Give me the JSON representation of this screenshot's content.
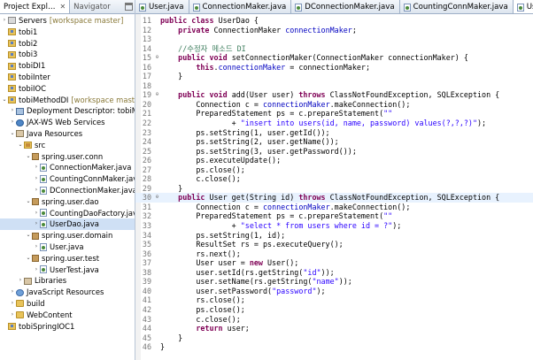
{
  "explorer": {
    "tab_label": "Project Expl…",
    "tab_close": "✕",
    "navigator_label": "Navigator",
    "tree": [
      {
        "depth": 0,
        "twisty": "›",
        "icon": "ic-serv",
        "icon_name": "server-icon",
        "label": "Servers",
        "ws": "[workspace master]"
      },
      {
        "depth": 0,
        "twisty": "",
        "icon": "ic-project",
        "icon_name": "project-icon",
        "label": "tobi1",
        "ws": ""
      },
      {
        "depth": 0,
        "twisty": "",
        "icon": "ic-project",
        "icon_name": "project-icon",
        "label": "tobi2",
        "ws": ""
      },
      {
        "depth": 0,
        "twisty": "",
        "icon": "ic-project",
        "icon_name": "project-icon",
        "label": "tobi3",
        "ws": ""
      },
      {
        "depth": 0,
        "twisty": "",
        "icon": "ic-project",
        "icon_name": "project-icon",
        "label": "tobiDI1",
        "ws": ""
      },
      {
        "depth": 0,
        "twisty": "",
        "icon": "ic-project",
        "icon_name": "project-icon",
        "label": "tobiInter",
        "ws": ""
      },
      {
        "depth": 0,
        "twisty": "",
        "icon": "ic-project",
        "icon_name": "project-icon",
        "label": "tobiIOC",
        "ws": ""
      },
      {
        "depth": 0,
        "twisty": "⌄",
        "icon": "ic-project",
        "icon_name": "project-icon",
        "label": "tobiMethodDI",
        "ws": "[workspace master]"
      },
      {
        "depth": 1,
        "twisty": "›",
        "icon": "ic-dd",
        "icon_name": "deployment-descriptor-icon",
        "label": "Deployment Descriptor: tobiMethodD",
        "ws": ""
      },
      {
        "depth": 1,
        "twisty": "›",
        "icon": "ic-jax",
        "icon_name": "web-services-icon",
        "label": "JAX-WS Web Services",
        "ws": ""
      },
      {
        "depth": 1,
        "twisty": "⌄",
        "icon": "ic-lib",
        "icon_name": "java-resources-icon",
        "label": "Java Resources",
        "ws": ""
      },
      {
        "depth": 2,
        "twisty": "⌄",
        "icon": "ic-src",
        "icon_name": "source-folder-icon",
        "label": "src",
        "ws": ""
      },
      {
        "depth": 3,
        "twisty": "⌄",
        "icon": "ic-pkg",
        "icon_name": "package-icon",
        "label": "spring.user.conn",
        "ws": ""
      },
      {
        "depth": 4,
        "twisty": "›",
        "icon": "ic-java",
        "icon_name": "java-file-icon",
        "label": "ConnectionMaker.java",
        "ws": ""
      },
      {
        "depth": 4,
        "twisty": "›",
        "icon": "ic-java",
        "icon_name": "java-file-icon",
        "label": "CountingConnMaker.java",
        "ws": ""
      },
      {
        "depth": 4,
        "twisty": "›",
        "icon": "ic-java",
        "icon_name": "java-file-icon",
        "label": "DConnectionMaker.java",
        "ws": ""
      },
      {
        "depth": 3,
        "twisty": "⌄",
        "icon": "ic-pkg",
        "icon_name": "package-icon",
        "label": "spring.user.dao",
        "ws": ""
      },
      {
        "depth": 4,
        "twisty": "›",
        "icon": "ic-java",
        "icon_name": "java-file-icon",
        "label": "CountingDaoFactory.java",
        "ws": ""
      },
      {
        "depth": 4,
        "twisty": "›",
        "icon": "ic-java",
        "icon_name": "java-file-icon",
        "label": "UserDao.java",
        "ws": "",
        "selected": true
      },
      {
        "depth": 3,
        "twisty": "⌄",
        "icon": "ic-pkg",
        "icon_name": "package-icon",
        "label": "spring.user.domain",
        "ws": ""
      },
      {
        "depth": 4,
        "twisty": "›",
        "icon": "ic-java",
        "icon_name": "java-file-icon",
        "label": "User.java",
        "ws": ""
      },
      {
        "depth": 3,
        "twisty": "⌄",
        "icon": "ic-pkg",
        "icon_name": "package-icon",
        "label": "spring.user.test",
        "ws": ""
      },
      {
        "depth": 4,
        "twisty": "›",
        "icon": "ic-java",
        "icon_name": "java-file-icon",
        "label": "UserTest.java",
        "ws": ""
      },
      {
        "depth": 2,
        "twisty": "›",
        "icon": "ic-lib",
        "icon_name": "libraries-icon",
        "label": "Libraries",
        "ws": ""
      },
      {
        "depth": 1,
        "twisty": "›",
        "icon": "ic-web",
        "icon_name": "javascript-resources-icon",
        "label": "JavaScript Resources",
        "ws": ""
      },
      {
        "depth": 1,
        "twisty": "›",
        "icon": "ic-folder",
        "icon_name": "folder-icon",
        "label": "build",
        "ws": ""
      },
      {
        "depth": 1,
        "twisty": "›",
        "icon": "ic-folder",
        "icon_name": "folder-icon",
        "label": "WebContent",
        "ws": ""
      },
      {
        "depth": 0,
        "twisty": "",
        "icon": "ic-project",
        "icon_name": "project-icon",
        "label": "tobiSpringIOC1",
        "ws": ""
      }
    ]
  },
  "editor_tabs": [
    {
      "label": "User.java",
      "active": false
    },
    {
      "label": "ConnectionMaker.java",
      "active": false
    },
    {
      "label": "DConnectionMaker.java",
      "active": false
    },
    {
      "label": "CountingConnMaker.java",
      "active": false
    },
    {
      "label": "UserDao.java",
      "active": true
    }
  ],
  "tab_close": "✕",
  "code": [
    {
      "n": "11",
      "f": "",
      "t": [
        [
          "kw",
          "public class "
        ],
        [
          "",
          "UserDao {"
        ]
      ]
    },
    {
      "n": "12",
      "f": "",
      "t": [
        [
          "",
          "    "
        ],
        [
          "kw",
          "private "
        ],
        [
          "",
          "ConnectionMaker "
        ],
        [
          "fld",
          "connectionMaker"
        ],
        [
          "",
          ";"
        ]
      ]
    },
    {
      "n": "13",
      "f": "",
      "t": [
        [
          "",
          ""
        ]
      ]
    },
    {
      "n": "14",
      "f": "",
      "t": [
        [
          "",
          "    "
        ],
        [
          "cm",
          "//수정자 메소드 DI"
        ]
      ]
    },
    {
      "n": "15",
      "f": "⊖",
      "t": [
        [
          "",
          "    "
        ],
        [
          "kw",
          "public void "
        ],
        [
          "",
          "setConnectionMaker(ConnectionMaker connectionMaker) {"
        ]
      ]
    },
    {
      "n": "16",
      "f": "",
      "t": [
        [
          "",
          "        "
        ],
        [
          "kw",
          "this"
        ],
        [
          "",
          "."
        ],
        [
          "fld",
          "connectionMaker"
        ],
        [
          "",
          " = connectionMaker;"
        ]
      ]
    },
    {
      "n": "17",
      "f": "",
      "t": [
        [
          "",
          "    }"
        ]
      ]
    },
    {
      "n": "18",
      "f": "",
      "t": [
        [
          "",
          ""
        ]
      ]
    },
    {
      "n": "19",
      "f": "⊖",
      "t": [
        [
          "",
          "    "
        ],
        [
          "kw",
          "public void "
        ],
        [
          "",
          "add(User user) "
        ],
        [
          "kw",
          "throws "
        ],
        [
          "",
          "ClassNotFoundException, SQLException {"
        ]
      ]
    },
    {
      "n": "20",
      "f": "",
      "t": [
        [
          "",
          "        Connection c = "
        ],
        [
          "fld",
          "connectionMaker"
        ],
        [
          "",
          ".makeConnection();"
        ]
      ]
    },
    {
      "n": "21",
      "f": "",
      "t": [
        [
          "",
          "        PreparedStatement ps = c.prepareStatement("
        ],
        [
          "str",
          "\"\""
        ]
      ]
    },
    {
      "n": "22",
      "f": "",
      "t": [
        [
          "",
          "                + "
        ],
        [
          "str",
          "\"insert into users(id, name, password) values(?,?,?)\""
        ],
        [
          "",
          ");"
        ]
      ]
    },
    {
      "n": "23",
      "f": "",
      "t": [
        [
          "",
          "        ps.setString(1, user.getId());"
        ]
      ]
    },
    {
      "n": "24",
      "f": "",
      "t": [
        [
          "",
          "        ps.setString(2, user.getName());"
        ]
      ]
    },
    {
      "n": "25",
      "f": "",
      "t": [
        [
          "",
          "        ps.setString(3, user.getPassword());"
        ]
      ]
    },
    {
      "n": "26",
      "f": "",
      "t": [
        [
          "",
          "        ps.executeUpdate();"
        ]
      ]
    },
    {
      "n": "27",
      "f": "",
      "t": [
        [
          "",
          "        ps.close();"
        ]
      ]
    },
    {
      "n": "28",
      "f": "",
      "t": [
        [
          "",
          "        c.close();"
        ]
      ]
    },
    {
      "n": "29",
      "f": "",
      "t": [
        [
          "",
          "    }"
        ]
      ]
    },
    {
      "n": "30",
      "f": "⊖",
      "t": [
        [
          "",
          "    "
        ],
        [
          "kw",
          "public "
        ],
        [
          "",
          "User get(String id) "
        ],
        [
          "kw",
          "throws "
        ],
        [
          "",
          "ClassNotFoundException, SQLException {"
        ]
      ],
      "hl": true
    },
    {
      "n": "31",
      "f": "",
      "t": [
        [
          "",
          "        Connection c = "
        ],
        [
          "fld",
          "connectionMaker"
        ],
        [
          "",
          ".makeConnection();"
        ]
      ]
    },
    {
      "n": "32",
      "f": "",
      "t": [
        [
          "",
          "        PreparedStatement ps = c.prepareStatement("
        ],
        [
          "str",
          "\"\""
        ]
      ]
    },
    {
      "n": "33",
      "f": "",
      "t": [
        [
          "",
          "                + "
        ],
        [
          "str",
          "\"select * from users where id = ?\""
        ],
        [
          "",
          ");"
        ]
      ]
    },
    {
      "n": "34",
      "f": "",
      "t": [
        [
          "",
          "        ps.setString(1, id);"
        ]
      ]
    },
    {
      "n": "35",
      "f": "",
      "t": [
        [
          "",
          "        ResultSet rs = ps.executeQuery();"
        ]
      ]
    },
    {
      "n": "36",
      "f": "",
      "t": [
        [
          "",
          "        rs.next();"
        ]
      ]
    },
    {
      "n": "37",
      "f": "",
      "t": [
        [
          "",
          "        User user = "
        ],
        [
          "kw",
          "new "
        ],
        [
          "",
          "User();"
        ]
      ]
    },
    {
      "n": "38",
      "f": "",
      "t": [
        [
          "",
          "        user.setId(rs.getString("
        ],
        [
          "str",
          "\"id\""
        ],
        [
          "",
          "));"
        ]
      ]
    },
    {
      "n": "39",
      "f": "",
      "t": [
        [
          "",
          "        user.setName(rs.getString("
        ],
        [
          "str",
          "\"name\""
        ],
        [
          "",
          "));"
        ]
      ]
    },
    {
      "n": "40",
      "f": "",
      "t": [
        [
          "",
          "        user.setPassword("
        ],
        [
          "str",
          "\"password\""
        ],
        [
          "",
          ");"
        ]
      ]
    },
    {
      "n": "41",
      "f": "",
      "t": [
        [
          "",
          "        rs.close();"
        ]
      ]
    },
    {
      "n": "42",
      "f": "",
      "t": [
        [
          "",
          "        ps.close();"
        ]
      ]
    },
    {
      "n": "43",
      "f": "",
      "t": [
        [
          "",
          "        c.close();"
        ]
      ]
    },
    {
      "n": "44",
      "f": "",
      "t": [
        [
          "",
          "        "
        ],
        [
          "kw",
          "return "
        ],
        [
          "",
          "user;"
        ]
      ]
    },
    {
      "n": "45",
      "f": "",
      "t": [
        [
          "",
          "    }"
        ]
      ]
    },
    {
      "n": "46",
      "f": "",
      "t": [
        [
          "",
          "}"
        ]
      ]
    }
  ]
}
